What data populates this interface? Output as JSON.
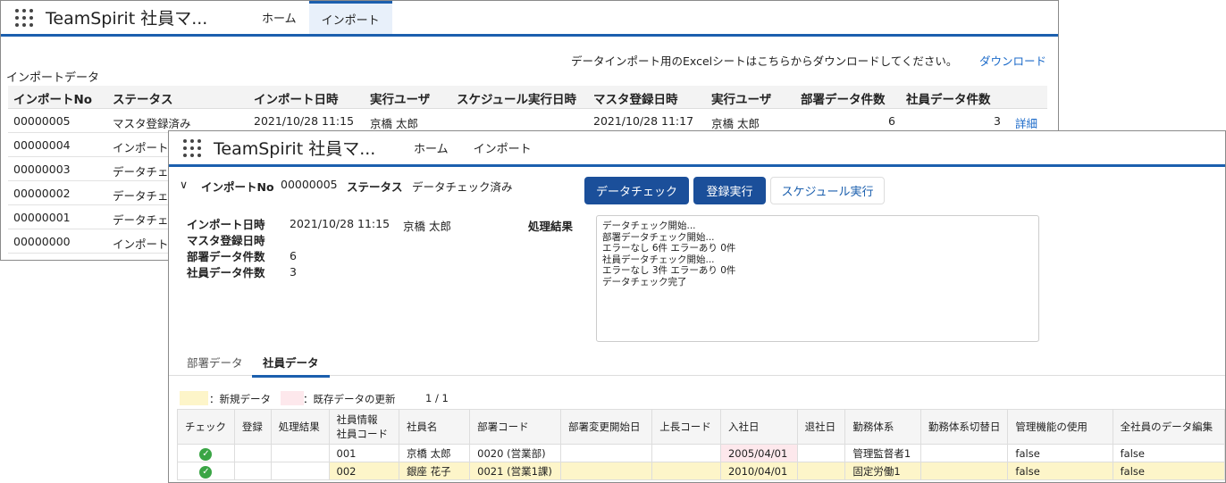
{
  "back": {
    "app_title": "TeamSpirit 社員マ...",
    "tabs": [
      "ホーム",
      "インポート"
    ],
    "download_note": "データインポート用のExcelシートはこちらからダウンロードしてください。",
    "download_link": "ダウンロード",
    "section_title": "インポートデータ",
    "columns": [
      "インポートNo",
      "ステータス",
      "インポート日時",
      "実行ユーザ",
      "スケジュール実行日時",
      "マスタ登録日時",
      "実行ユーザ",
      "部署データ件数",
      "社員データ件数"
    ],
    "rows": [
      {
        "no": "00000005",
        "status": "マスタ登録済み",
        "date": "2021/10/28 11:15",
        "user": "京橋 太郎",
        "master_date": "2021/10/28 11:17",
        "master_user": "京橋 太郎",
        "dept": "6",
        "emp": "3",
        "detail": "詳細"
      },
      {
        "no": "00000004",
        "status": "インポート"
      },
      {
        "no": "00000003",
        "status": "データチェ"
      },
      {
        "no": "00000002",
        "status": "データチェ"
      },
      {
        "no": "00000001",
        "status": "データチェ"
      },
      {
        "no": "00000000",
        "status": "インポート"
      }
    ]
  },
  "front": {
    "app_title": "TeamSpirit 社員マ...",
    "tabs": [
      "ホーム",
      "インポート"
    ],
    "summary": {
      "no_label": "インポートNo",
      "no": "00000005",
      "status_label": "ステータス",
      "status": "データチェック済み"
    },
    "buttons": [
      "データチェック",
      "登録実行",
      "スケジュール実行"
    ],
    "details": {
      "import_date_label": "インポート日時",
      "import_date": "2021/10/28 11:15",
      "user": "京橋 太郎",
      "master_date_label": "マスタ登録日時",
      "dept_count_label": "部署データ件数",
      "dept_count": "6",
      "emp_count_label": "社員データ件数",
      "emp_count": "3",
      "result_label": "処理結果",
      "result_lines": "データチェック開始...\n部署データチェック開始...\nエラーなし 6件 エラーあり 0件\n社員データチェック開始...\nエラーなし 3件 エラーあり 0件\nデータチェック完了"
    },
    "subtabs": [
      "部署データ",
      "社員データ"
    ],
    "legend": {
      "new": "：新規データ",
      "update": "：既存データの更新",
      "page": "1 / 1"
    },
    "columns": [
      "チェック",
      "登録",
      "処理結果",
      "社員情報\n社員コード",
      "社員名",
      "部署コード",
      "部署変更開始日",
      "上長コード",
      "入社日",
      "退社日",
      "勤務体系",
      "勤務体系切替日",
      "管理機能の使用",
      "全社員のデータ編集"
    ],
    "rows": [
      {
        "code": "001",
        "name": "京橋 太郎",
        "dept": "0020 (営業部)",
        "join": "2005/04/01",
        "work": "管理監督者1",
        "admin": "false",
        "all": "false"
      },
      {
        "code": "002",
        "name": "銀座 花子",
        "dept": "0021 (営業1課)",
        "join": "2010/04/01",
        "work": "固定労働1",
        "admin": "false",
        "all": "false"
      }
    ]
  },
  "colors": {
    "accent": "#1b5fae",
    "new_row": "#fdf5c9",
    "update_cell": "#fde8ec"
  }
}
